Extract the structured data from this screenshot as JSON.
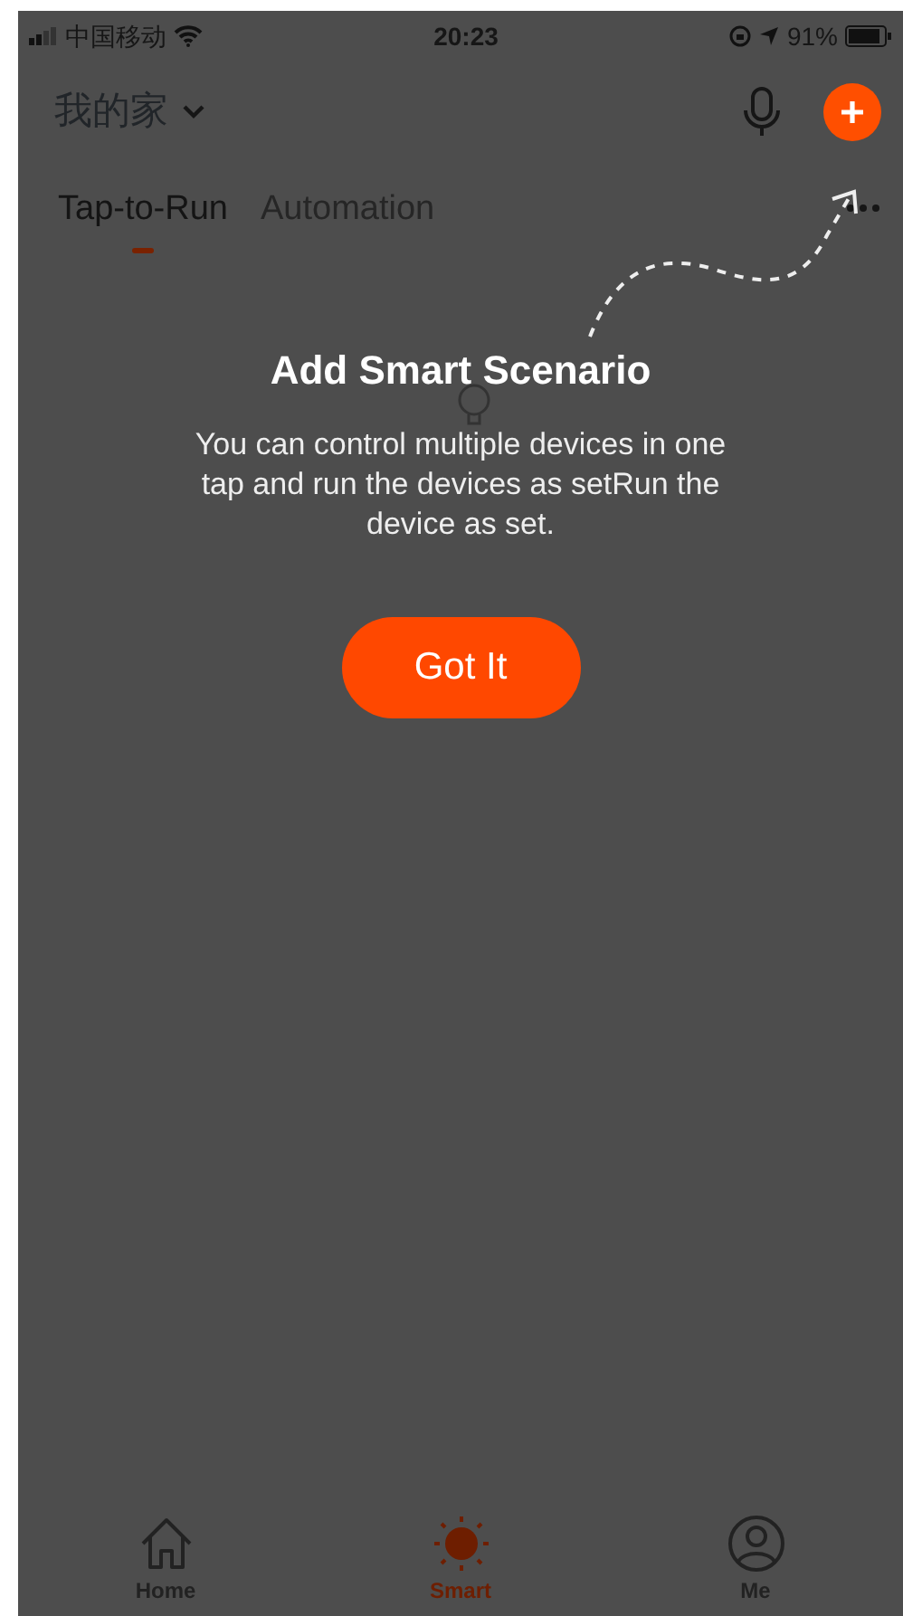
{
  "status_bar": {
    "carrier": "中国移动",
    "time": "20:23",
    "battery": "91%"
  },
  "header": {
    "home_name": "我的家"
  },
  "tabs": [
    {
      "label": "Tap-to-Run",
      "selected": true
    },
    {
      "label": "Automation",
      "selected": false
    }
  ],
  "guide": {
    "title": "Add Smart Scenario",
    "body": "You can control multiple devices in one tap and run the devices as setRun the device as set.",
    "button": "Got It"
  },
  "bottom_nav": [
    {
      "kind": "home",
      "label": "Home",
      "selected": false
    },
    {
      "kind": "smart",
      "label": "Smart",
      "selected": true
    },
    {
      "kind": "me",
      "label": "Me",
      "selected": false
    }
  ]
}
